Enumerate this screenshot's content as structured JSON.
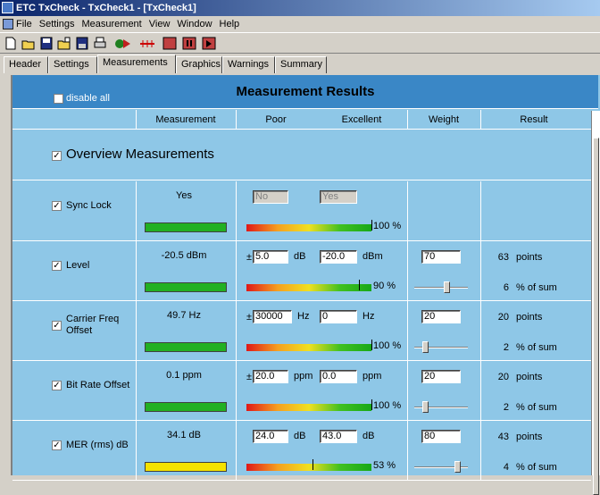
{
  "window": {
    "title": "ETC TxCheck - TxCheck1 - [TxCheck1]"
  },
  "menu": [
    "File",
    "Settings",
    "Measurement",
    "View",
    "Window",
    "Help"
  ],
  "tabs": [
    "Header",
    "Settings",
    "Measurements",
    "Graphics",
    "Warnings",
    "Summary"
  ],
  "active_tab": "Measurements",
  "panel": {
    "title": "Measurement Results",
    "disable_all": "disable all",
    "section": "Overview Measurements"
  },
  "columns": {
    "measurement": "Measurement",
    "poor": "Poor",
    "excellent": "Excellent",
    "weight": "Weight",
    "result": "Result"
  },
  "rows": [
    {
      "label": "Sync Lock",
      "checked": true,
      "value": "Yes",
      "bar_color": "green",
      "poor": "No",
      "excellent": "Yes",
      "inputs_disabled": true,
      "quality_pct": 100,
      "pct_label": "100 %",
      "weight": "",
      "points": "",
      "percent": ""
    },
    {
      "label": "Level",
      "checked": true,
      "value": "-20.5 dBm",
      "bar_color": "green",
      "pm": "±",
      "poor": "5.0",
      "poor_unit": "dB",
      "excellent": "-20.0",
      "exc_unit": "dBm",
      "quality_pct": 90,
      "pct_label": "90 %",
      "weight": "70",
      "weight_slider": 0.6,
      "points": "63",
      "points_label": "points",
      "percent": "6",
      "percent_label": "% of sum"
    },
    {
      "label": "Carrier Freq Offset",
      "checked": true,
      "value": "49.7 Hz",
      "bar_color": "green",
      "pm": "±",
      "poor": "30000",
      "poor_unit": "Hz",
      "excellent": "0",
      "exc_unit": "Hz",
      "quality_pct": 100,
      "pct_label": "100 %",
      "weight": "20",
      "weight_slider": 0.2,
      "points": "20",
      "points_label": "points",
      "percent": "2",
      "percent_label": "% of sum"
    },
    {
      "label": "Bit Rate Offset",
      "checked": true,
      "value": "0.1 ppm",
      "bar_color": "green",
      "pm": "±",
      "poor": "20.0",
      "poor_unit": "ppm",
      "excellent": "0.0",
      "exc_unit": "ppm",
      "quality_pct": 100,
      "pct_label": "100 %",
      "weight": "20",
      "weight_slider": 0.2,
      "points": "20",
      "points_label": "points",
      "percent": "2",
      "percent_label": "% of sum"
    },
    {
      "label": "MER (rms) dB",
      "checked": true,
      "value": "34.1 dB",
      "bar_color": "yellow",
      "pm": "",
      "poor": "24.0",
      "poor_unit": "dB",
      "excellent": "43.0",
      "exc_unit": "dB",
      "quality_pct": 53,
      "pct_label": "53 %",
      "weight": "80",
      "weight_slider": 0.8,
      "points": "43",
      "points_label": "points",
      "percent": "4",
      "percent_label": "% of sum"
    }
  ],
  "colors": {
    "panel": "#8ec7e7",
    "header": "#3a87c6",
    "good": "#22b022",
    "warn": "#f5e200"
  }
}
